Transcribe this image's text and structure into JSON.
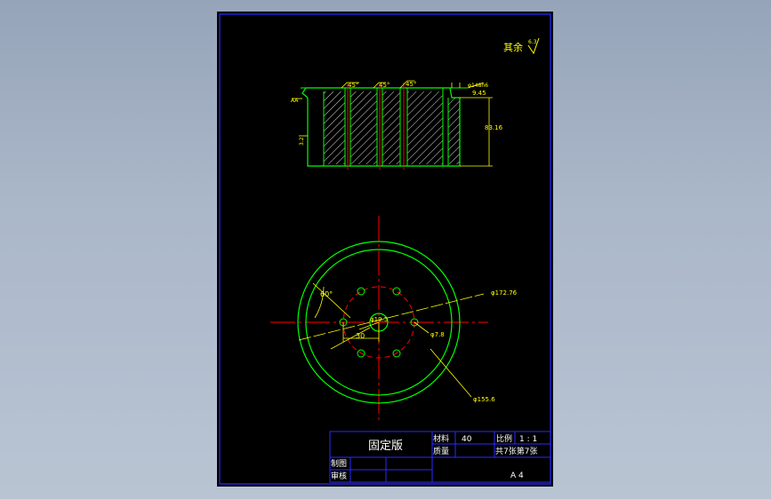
{
  "drawing": {
    "roughness_note": {
      "prefix": "其余",
      "value": "6.3"
    },
    "section": {
      "chamfer_1": "45°",
      "chamfer_2": "45°",
      "chamfer_3": "45°",
      "top_fit": "φ148h6",
      "step": "9.45",
      "height": "83.16",
      "left_mark_top": "AA",
      "left_mark_mid": "3.2"
    },
    "plan": {
      "angle": "60°",
      "outer_diameter": "φ172.76",
      "center_hole": "φ19.5",
      "bolt_hole": "φ7.8",
      "offset": "30",
      "bolt_circle": "φ155.6"
    }
  },
  "title_block": {
    "title": "固定版",
    "material_label": "材料",
    "material_value": "40",
    "scale_label": "比例",
    "scale_value": "1 : 1",
    "mass_label": "质量",
    "sheets": "共7张第7张",
    "drawn_label": "制图",
    "checked_label": "审核",
    "paper_size": "A 4"
  },
  "colors": {
    "background": "#000000",
    "frame": "#2a2aff",
    "outline": "#00ff00",
    "center_line": "#ff0000",
    "dimension": "#ffff00",
    "hatch": "#ffffff",
    "text": "#ffffff"
  }
}
